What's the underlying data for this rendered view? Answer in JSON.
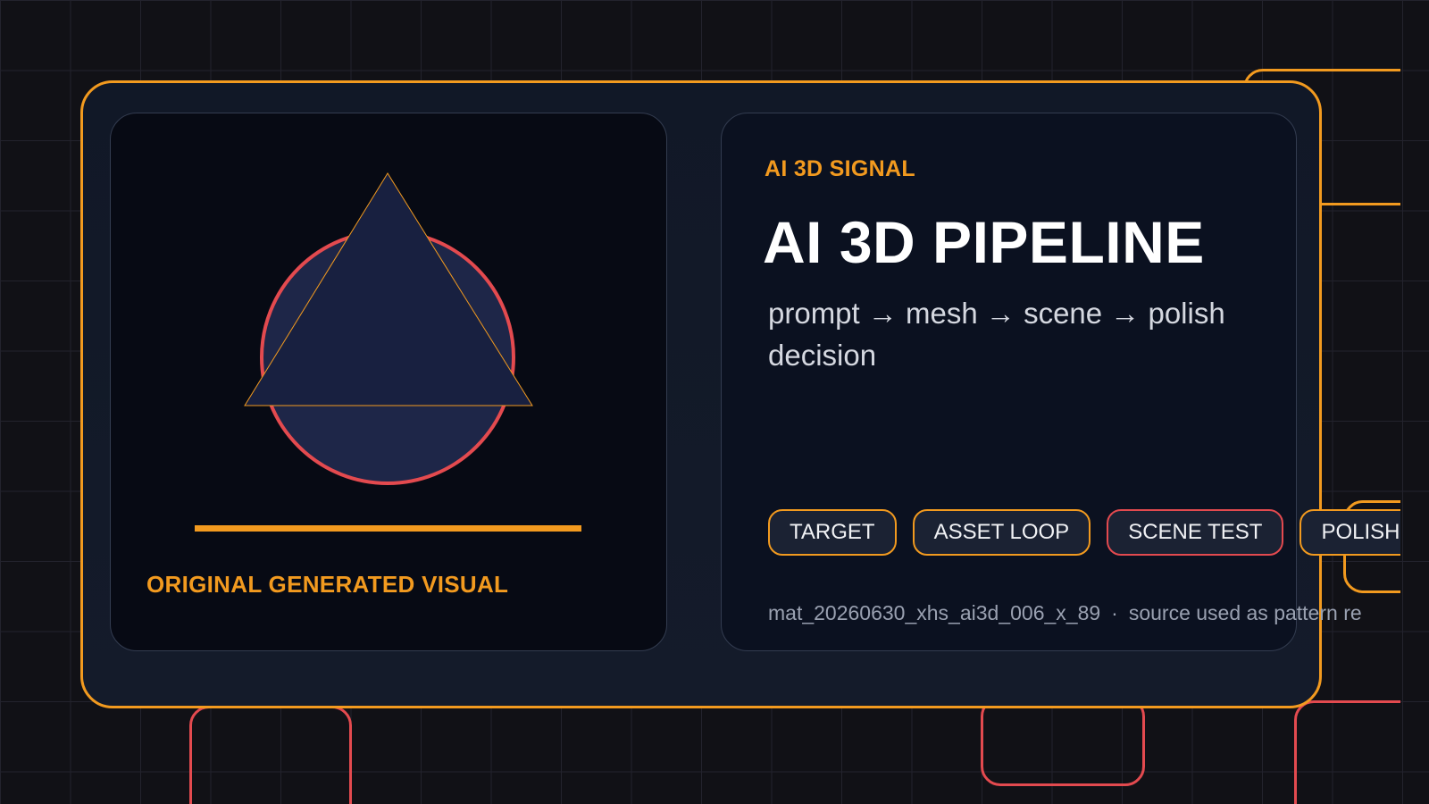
{
  "colors": {
    "accent": "#f29a1f",
    "alert": "#e34a4f",
    "background": "#111116",
    "card": "#111827",
    "shape_fill": "#1e2648"
  },
  "visual": {
    "label": "ORIGINAL GENERATED VISUAL"
  },
  "info": {
    "eyebrow": "AI 3D SIGNAL",
    "title": "AI 3D PIPELINE",
    "subtitle": "prompt → mesh → scene → polish decision",
    "chips": [
      {
        "label": "TARGET",
        "tone": "accent"
      },
      {
        "label": "ASSET LOOP",
        "tone": "accent"
      },
      {
        "label": "SCENE TEST",
        "tone": "alert"
      },
      {
        "label": "POLISH",
        "tone": "accent"
      }
    ],
    "footer": {
      "id": "mat_20260630_xhs_ai3d_006_x_89",
      "separator": "·",
      "note": "source used as pattern re"
    }
  }
}
